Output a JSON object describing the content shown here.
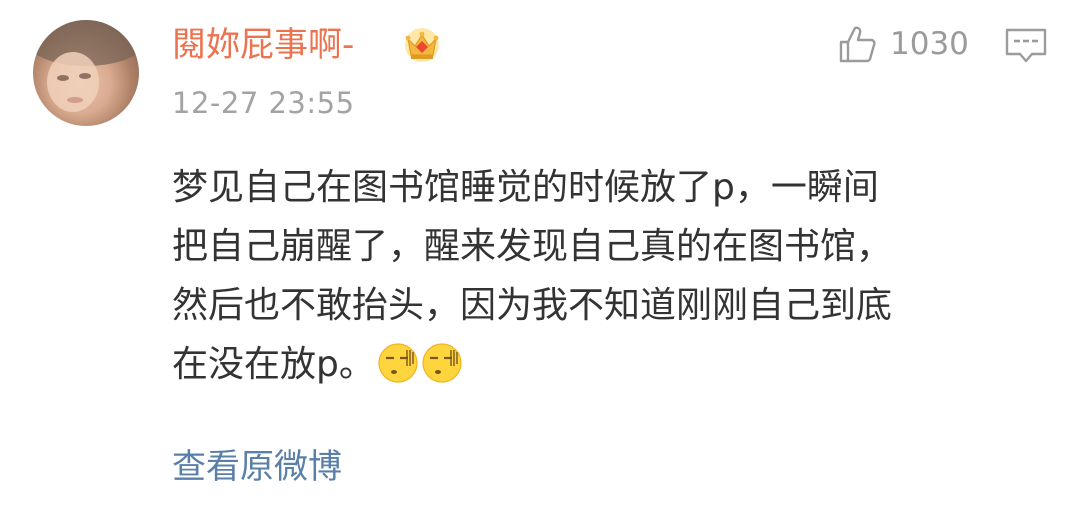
{
  "comment": {
    "username": "閱妳屁事啊-",
    "timestamp": "12-27 23:55",
    "likes": "1030",
    "content_lines": [
      "梦见自己在图书馆睡觉的时候放了p，一瞬间",
      "把自己崩醒了，醒来发现自己真的在图书馆，",
      "然后也不敢抬头，因为我不知道刚刚自己到底",
      "在没在放p。"
    ],
    "emoji_names": [
      "awkward-face-emoji",
      "awkward-face-emoji"
    ],
    "view_original": "查看原微博"
  },
  "icons": {
    "badge": "crown-icon",
    "like": "thumbs-up-icon",
    "reply": "comment-icon"
  },
  "colors": {
    "username": "#eb7350",
    "timestamp": "#a3a3a3",
    "text": "#333333",
    "link": "#5a7fa8",
    "icon_gray": "#9b9b9b",
    "crown_gold": "#f4b840"
  }
}
